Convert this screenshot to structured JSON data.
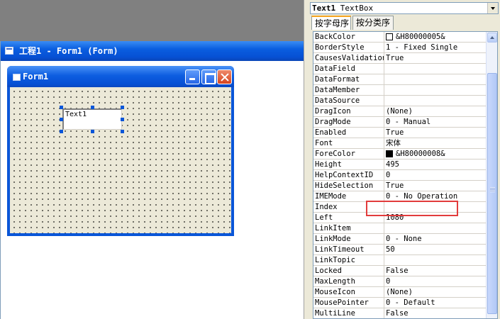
{
  "designer": {
    "window_title": "工程1 - Form1 (Form)",
    "form_title": "Form1",
    "textbox_text": "Text1"
  },
  "properties": {
    "object_name": "Text1",
    "object_type": "TextBox",
    "tabs": [
      {
        "label": "按字母序",
        "active": true
      },
      {
        "label": "按分类序",
        "active": false
      }
    ],
    "rows": [
      {
        "name": "BackColor",
        "value": "&H80000005&",
        "swatch": "#ffffff"
      },
      {
        "name": "BorderStyle",
        "value": "1 - Fixed Single"
      },
      {
        "name": "CausesValidation",
        "value": "True"
      },
      {
        "name": "DataField",
        "value": ""
      },
      {
        "name": "DataFormat",
        "value": ""
      },
      {
        "name": "DataMember",
        "value": ""
      },
      {
        "name": "DataSource",
        "value": ""
      },
      {
        "name": "DragIcon",
        "value": " (None)"
      },
      {
        "name": "DragMode",
        "value": "0 - Manual"
      },
      {
        "name": "Enabled",
        "value": "True"
      },
      {
        "name": "Font",
        "value": "宋体"
      },
      {
        "name": "ForeColor",
        "value": "&H80000008&",
        "swatch": "#000000"
      },
      {
        "name": "Height",
        "value": "495"
      },
      {
        "name": "HelpContextID",
        "value": "0"
      },
      {
        "name": "HideSelection",
        "value": "True"
      },
      {
        "name": "IMEMode",
        "value": "0 - No Operation"
      },
      {
        "name": "Index",
        "value": ""
      },
      {
        "name": "Left",
        "value": "1080"
      },
      {
        "name": "LinkItem",
        "value": ""
      },
      {
        "name": "LinkMode",
        "value": "0 - None"
      },
      {
        "name": "LinkTimeout",
        "value": "50"
      },
      {
        "name": "LinkTopic",
        "value": ""
      },
      {
        "name": "Locked",
        "value": "False"
      },
      {
        "name": "MaxLength",
        "value": "0"
      },
      {
        "name": "MouseIcon",
        "value": " (None)"
      },
      {
        "name": "MousePointer",
        "value": "0 - Default"
      },
      {
        "name": "MultiLine",
        "value": "False"
      }
    ]
  },
  "colors": {
    "xp_title_blue": "#0a56d8",
    "form_bg": "#ece9d8",
    "highlight_red": "#e23c3c"
  }
}
